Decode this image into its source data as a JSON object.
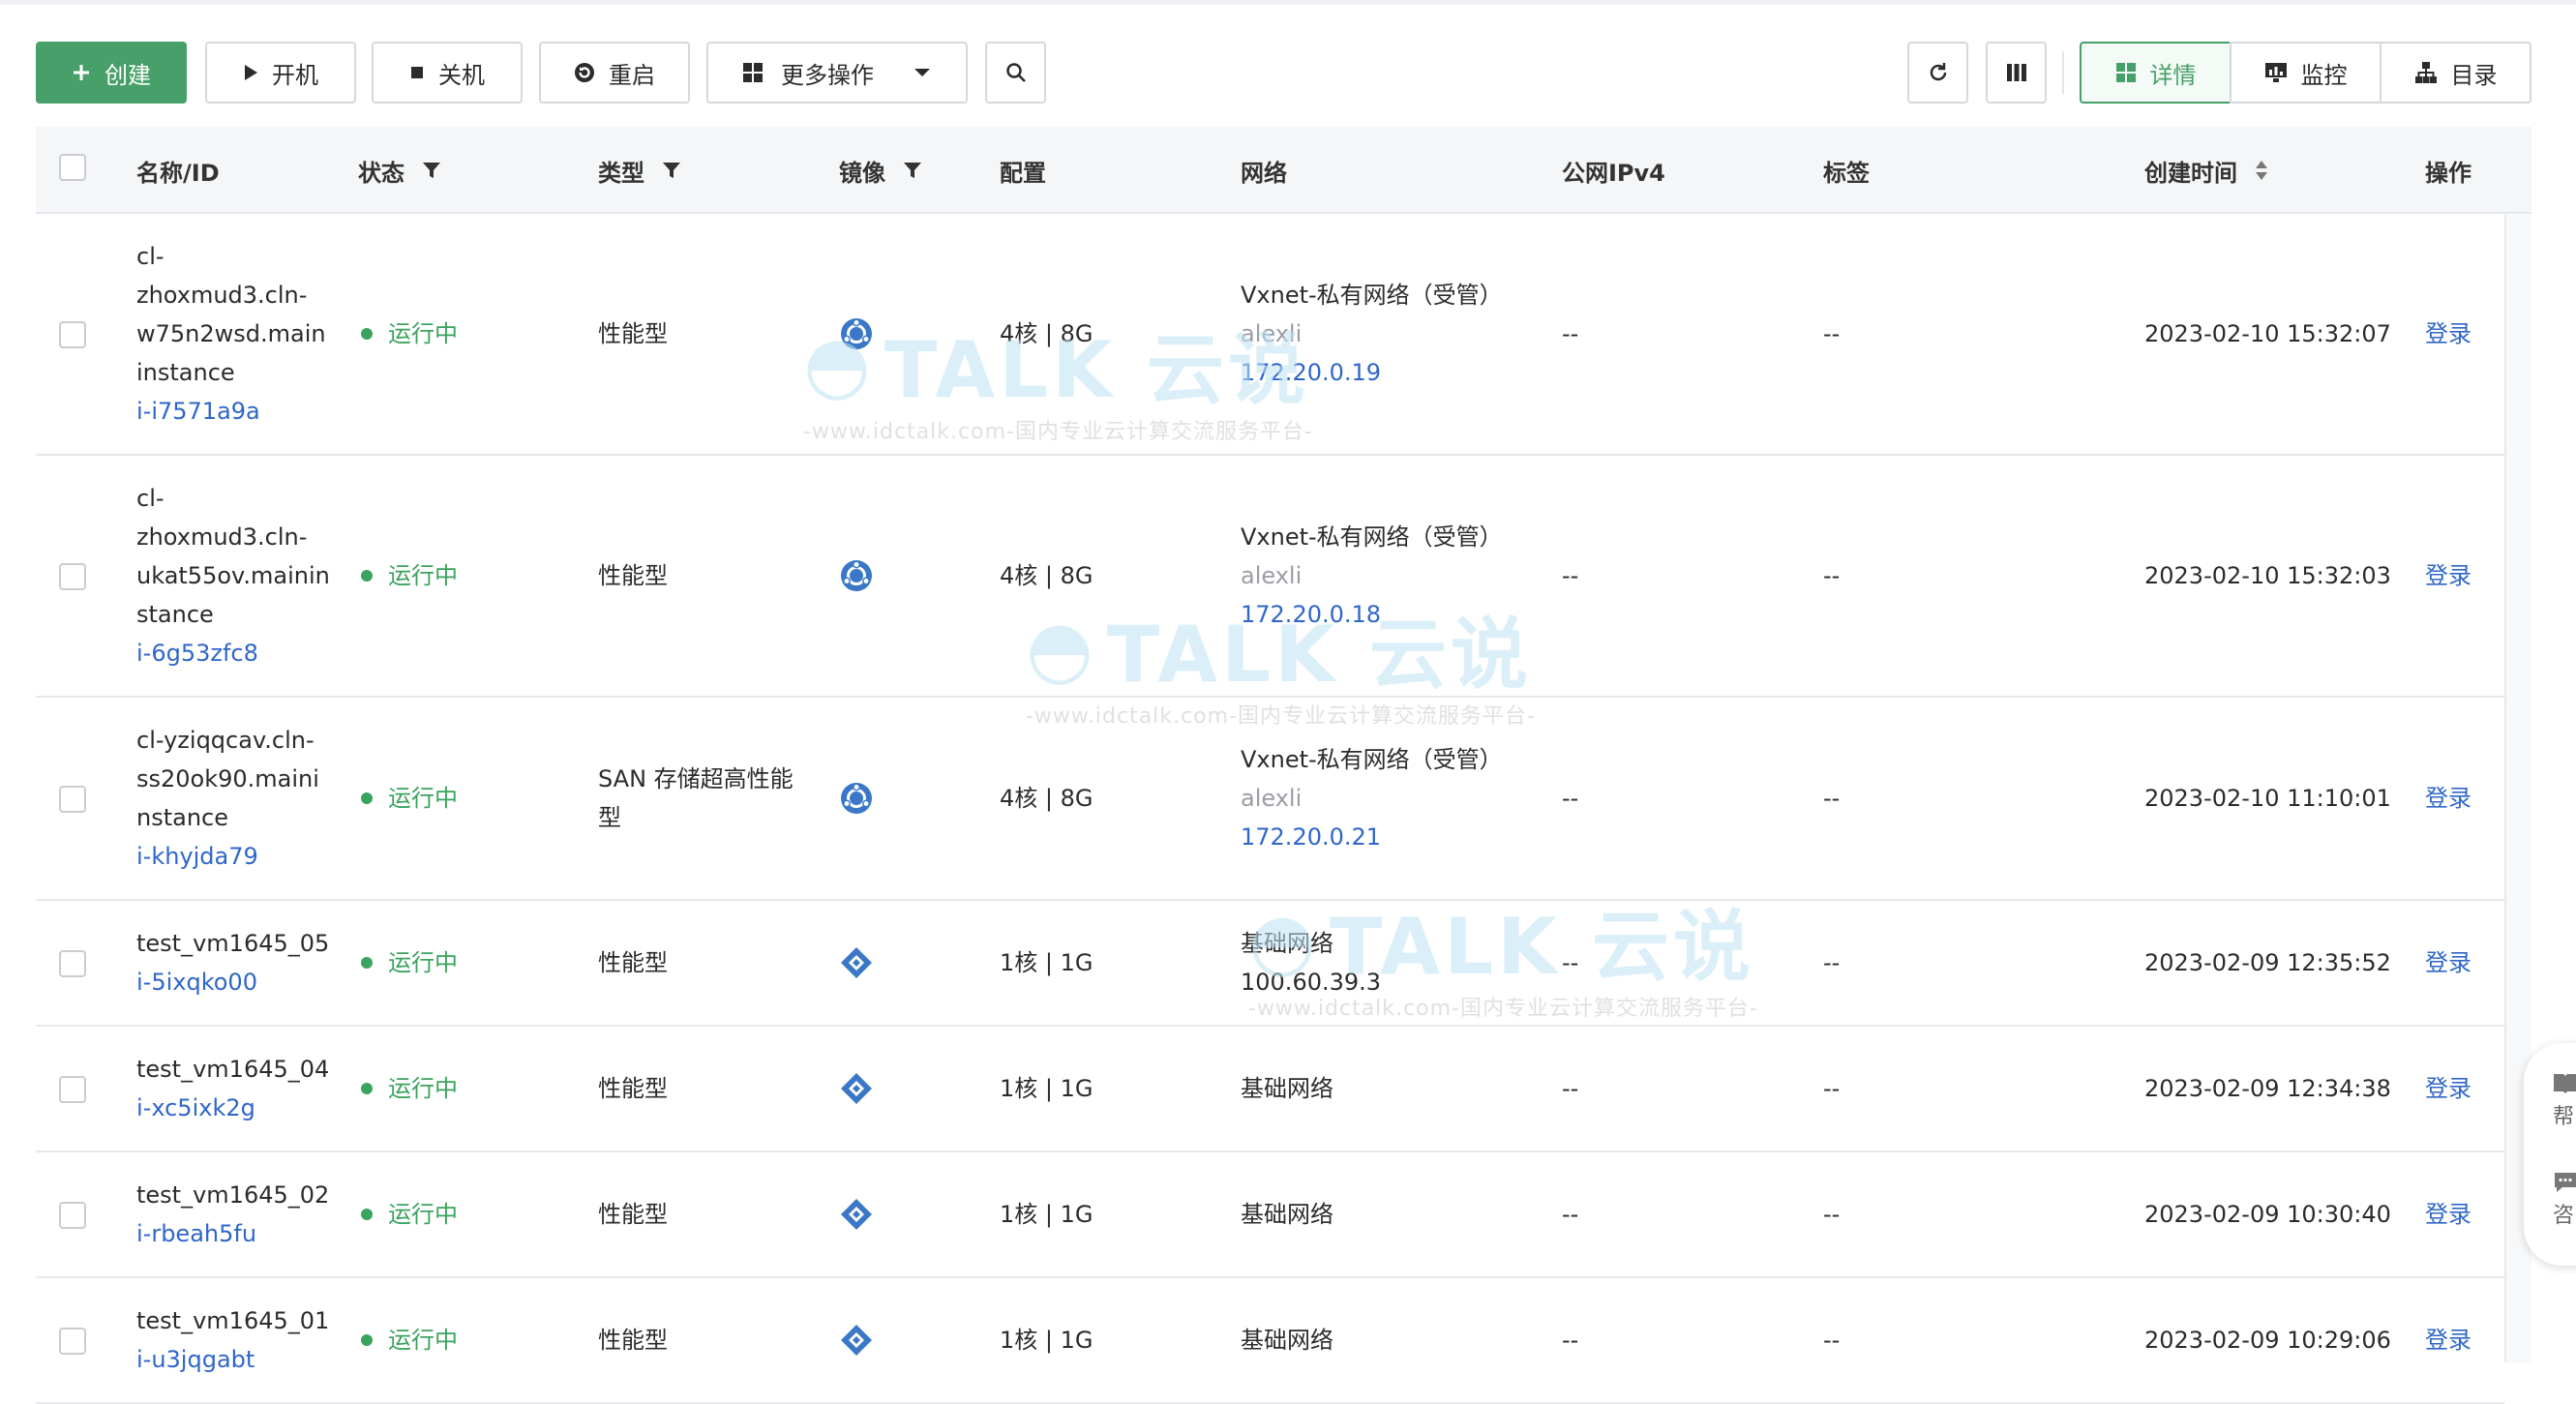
{
  "toolbar": {
    "create_label": "创建",
    "start_label": "开机",
    "stop_label": "关机",
    "restart_label": "重启",
    "more_label": "更多操作",
    "view_detail_label": "详情",
    "view_monitor_label": "监控",
    "view_catalog_label": "目录"
  },
  "columns": {
    "name": "名称/ID",
    "status": "状态",
    "type": "类型",
    "image": "镜像",
    "config": "配置",
    "network": "网络",
    "ipv4": "公网IPv4",
    "tags": "标签",
    "created": "创建时间",
    "action": "操作"
  },
  "rows": [
    {
      "name_lines": [
        "cl-",
        "zhoxmud3.cln-",
        "w75n2wsd.main",
        "instance"
      ],
      "id": "i-i7571a9a",
      "status": "运行中",
      "type_lines": [
        "性能型"
      ],
      "image_icon": "ubuntu-icon",
      "config": "4核 | 8G",
      "network_name": "Vxnet-私有网络（受管）",
      "network_owner": "alexli",
      "network_ip": "172.20.0.19",
      "ipv4": "--",
      "tags": "--",
      "created": "2023-02-10 15:32:07",
      "action": "登录"
    },
    {
      "name_lines": [
        "cl-",
        "zhoxmud3.cln-",
        "ukat55ov.mainin",
        "stance"
      ],
      "id": "i-6g53zfc8",
      "status": "运行中",
      "type_lines": [
        "性能型"
      ],
      "image_icon": "ubuntu-icon",
      "config": "4核 | 8G",
      "network_name": "Vxnet-私有网络（受管）",
      "network_owner": "alexli",
      "network_ip": "172.20.0.18",
      "ipv4": "--",
      "tags": "--",
      "created": "2023-02-10 15:32:03",
      "action": "登录"
    },
    {
      "name_lines": [
        "cl-yziqqcav.cln-",
        "ss20ok90.maini",
        "nstance"
      ],
      "id": "i-khyjda79",
      "status": "运行中",
      "type_lines": [
        "SAN 存储超高性能",
        "型"
      ],
      "image_icon": "ubuntu-icon",
      "config": "4核 | 8G",
      "network_name": "Vxnet-私有网络（受管）",
      "network_owner": "alexli",
      "network_ip": "172.20.0.21",
      "ipv4": "--",
      "tags": "--",
      "created": "2023-02-10 11:10:01",
      "action": "登录"
    },
    {
      "name_lines": [
        "test_vm1645_05"
      ],
      "id": "i-5ixqko00",
      "status": "运行中",
      "type_lines": [
        "性能型"
      ],
      "image_icon": "diamond-os-icon",
      "config": "1核 | 1G",
      "network_name": "基础网络",
      "network_owner": "",
      "network_ip": "100.60.39.3",
      "ipv4": "--",
      "tags": "--",
      "created": "2023-02-09 12:35:52",
      "action": "登录"
    },
    {
      "name_lines": [
        "test_vm1645_04"
      ],
      "id": "i-xc5ixk2g",
      "status": "运行中",
      "type_lines": [
        "性能型"
      ],
      "image_icon": "diamond-os-icon",
      "config": "1核 | 1G",
      "network_name": "基础网络",
      "network_owner": "",
      "network_ip": "",
      "ipv4": "--",
      "tags": "--",
      "created": "2023-02-09 12:34:38",
      "action": "登录"
    },
    {
      "name_lines": [
        "test_vm1645_02"
      ],
      "id": "i-rbeah5fu",
      "status": "运行中",
      "type_lines": [
        "性能型"
      ],
      "image_icon": "diamond-os-icon",
      "config": "1核 | 1G",
      "network_name": "基础网络",
      "network_owner": "",
      "network_ip": "",
      "ipv4": "--",
      "tags": "--",
      "created": "2023-02-09 10:30:40",
      "action": "登录"
    },
    {
      "name_lines": [
        "test_vm1645_01"
      ],
      "id": "i-u3jqgabt",
      "status": "运行中",
      "type_lines": [
        "性能型"
      ],
      "image_icon": "diamond-os-icon",
      "config": "1核 | 1G",
      "network_name": "基础网络",
      "network_owner": "",
      "network_ip": "",
      "ipv4": "--",
      "tags": "--",
      "created": "2023-02-09 10:29:06",
      "action": "登录"
    }
  ],
  "side_widget": {
    "help_label": "帮",
    "consult_label": "咨"
  },
  "watermark": {
    "brand": "TALK 云说",
    "tagline": "-www.idctalk.com-国内专业云计算交流服务平台-"
  },
  "colors": {
    "primary": "#47a069",
    "running": "#3aa35d",
    "link": "#2f66c9"
  }
}
